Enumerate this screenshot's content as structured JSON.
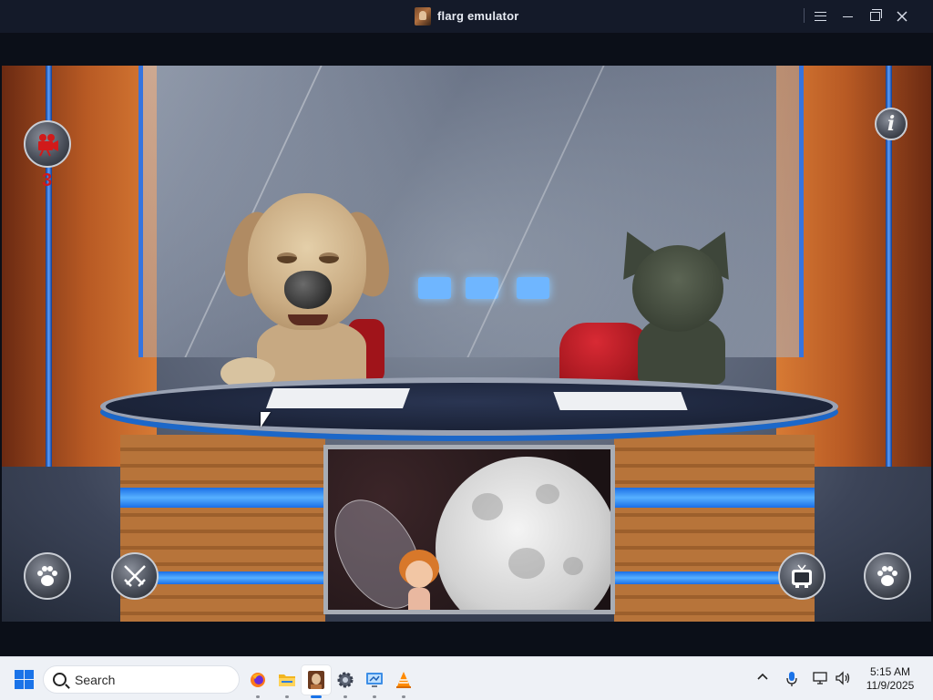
{
  "window": {
    "title": "flarg emulator",
    "icons": {
      "app": "flarg-app-icon",
      "menu": "hamburger-menu-icon",
      "minimize": "minimize-icon",
      "maximize": "restore-icon",
      "close": "close-icon"
    }
  },
  "game": {
    "video_count": "3",
    "info_label": "i",
    "buttons": {
      "camera": "video-camera-icon",
      "info": "info-icon",
      "paw_left": "paw-icon",
      "swords": "crossed-swords-icon",
      "tv": "tv-icon",
      "paw_right": "paw-icon"
    }
  },
  "android_nav": {
    "back": "back-icon",
    "home": "home-icon",
    "recents": "recent-apps-icon"
  },
  "taskbar": {
    "search_placeholder": "Search",
    "apps": [
      "firefox-icon",
      "file-explorer-icon",
      "flarg-emulator-icon",
      "settings-icon",
      "control-panel-icon",
      "vlc-icon"
    ],
    "active_app": "flarg-emulator-icon",
    "tray": [
      "chevron-up-icon",
      "microphone-icon",
      "network-icon",
      "speaker-icon"
    ],
    "clock": {
      "time": "5:15 AM",
      "date": "11/9/2025"
    }
  },
  "colors": {
    "titlebar": "#141a29",
    "taskbar": "#eef1f6",
    "accent": "#1a73e8",
    "video_count": "#d11a1a"
  }
}
